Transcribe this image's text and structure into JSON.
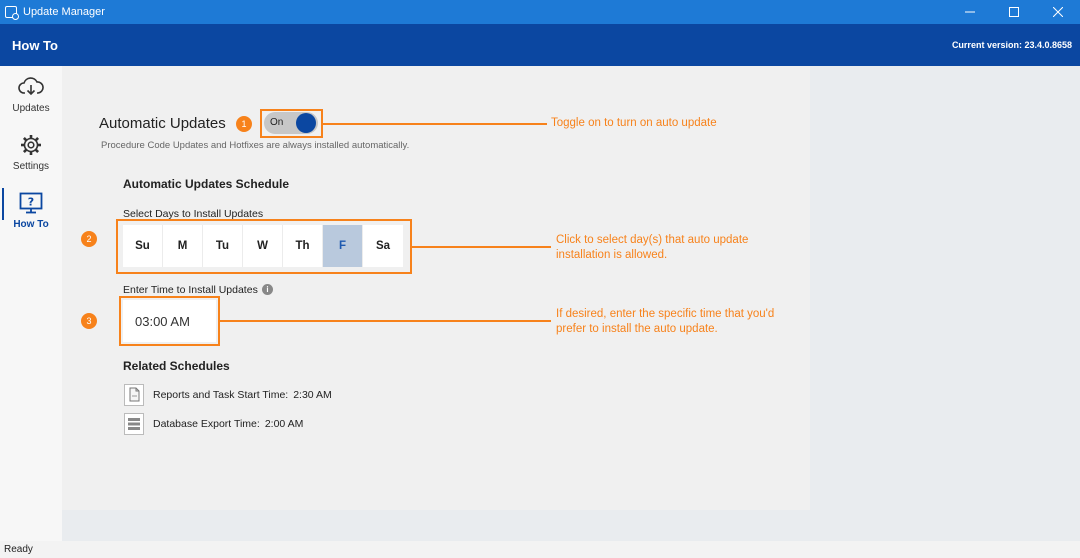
{
  "window": {
    "title": "Update Manager",
    "minimize_icon": "minimize-icon",
    "maximize_icon": "maximize-icon",
    "close_icon": "close-icon"
  },
  "header": {
    "title": "How To",
    "version": "Current version: 23.4.0.8658"
  },
  "sidebar": {
    "items": [
      {
        "label": "Updates",
        "icon": "cloud-download-icon",
        "active": false
      },
      {
        "label": "Settings",
        "icon": "gear-icon",
        "active": false
      },
      {
        "label": "How To",
        "icon": "help-monitor-icon",
        "active": true
      }
    ]
  },
  "automatic_updates": {
    "heading": "Automatic Updates",
    "toggle_label": "On",
    "toggle_state": true,
    "note": "Procedure Code Updates and Hotfixes are always installed automatically."
  },
  "schedule": {
    "heading": "Automatic Updates Schedule",
    "days_label": "Select Days to Install Updates",
    "days": [
      {
        "label": "Su",
        "selected": false
      },
      {
        "label": "M",
        "selected": false
      },
      {
        "label": "Tu",
        "selected": false
      },
      {
        "label": "W",
        "selected": false
      },
      {
        "label": "Th",
        "selected": false
      },
      {
        "label": "F",
        "selected": true
      },
      {
        "label": "Sa",
        "selected": false
      }
    ],
    "time_label": "Enter Time to Install Updates",
    "time_value": "03:00 AM"
  },
  "related": {
    "heading": "Related Schedules",
    "items": [
      {
        "label": "Reports and Task Start Time:",
        "value": "2:30 AM"
      },
      {
        "label": "Database Export Time:",
        "value": "2:00 AM"
      }
    ]
  },
  "annotations": {
    "badges": [
      "1",
      "2",
      "3"
    ],
    "callout1": "Toggle on to turn on auto update",
    "callout2_line1": "Click to select day(s) that auto update",
    "callout2_line2": "installation is allowed.",
    "callout3_line1": "If desired, enter the specific time that you'd",
    "callout3_line2": "prefer to install the auto update."
  },
  "status": {
    "text": "Ready"
  },
  "colors": {
    "titlebar": "#1e7ad6",
    "header": "#0b47a1",
    "accent_orange": "#f7821b",
    "selected_day": "#b9c9dd"
  }
}
